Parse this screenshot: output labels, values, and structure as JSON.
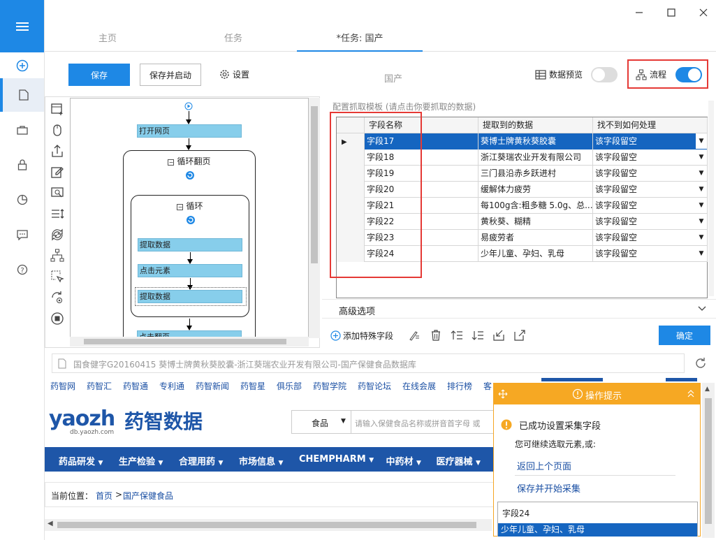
{
  "window": {
    "controls": [
      "minimize",
      "maximize",
      "close"
    ]
  },
  "tabs": [
    {
      "label": "主页"
    },
    {
      "label": "任务"
    },
    {
      "label": "*任务: 国产"
    }
  ],
  "toolbar": {
    "save": "保存",
    "save_start": "保存并启动",
    "settings": "设置",
    "task_name": "国产",
    "data_preview": "数据预览",
    "flow": "流程"
  },
  "flow": {
    "open_page": "打开网页",
    "loop_page": "循环翻页",
    "loop": "循环",
    "extract1": "提取数据",
    "click_elem": "点击元素",
    "extract2": "提取数据",
    "click_next": "点击翻页"
  },
  "config": {
    "title": "配置抓取模板 (请点击你要抓取的数据)",
    "columns": [
      "字段名称",
      "提取到的数据",
      "找不到如何处理"
    ],
    "rows": [
      {
        "name": "字段17",
        "data": "葵博士牌黄秋葵胶囊",
        "action": "该字段留空"
      },
      {
        "name": "字段18",
        "data": "浙江葵瑞农业开发有限公司",
        "action": "该字段留空"
      },
      {
        "name": "字段19",
        "data": "三门县沿赤乡跃进村",
        "action": "该字段留空"
      },
      {
        "name": "字段20",
        "data": "缓解体力疲劳",
        "action": "该字段留空"
      },
      {
        "name": "字段21",
        "data": "每100g含:粗多糖 5.0g、总...",
        "action": "该字段留空"
      },
      {
        "name": "字段22",
        "data": "黄秋葵、糊精",
        "action": "该字段留空"
      },
      {
        "name": "字段23",
        "data": "易疲劳者",
        "action": "该字段留空"
      },
      {
        "name": "字段24",
        "data": "少年儿童、孕妇、乳母",
        "action": "该字段留空"
      }
    ],
    "advanced": "高级选项",
    "add_special": "添加特殊字段",
    "confirm": "确定"
  },
  "browser": {
    "address": "国食健字G20160415 葵博士牌黄秋葵胶囊-浙江葵瑞农业开发有限公司-国产保健食品数据库",
    "site_nav": [
      "药智网",
      "药智汇",
      "药智通",
      "专利通",
      "药智新闻",
      "药智星",
      "俱乐部",
      "药智学院",
      "药智论坛",
      "在线会展",
      "排行榜",
      "客"
    ],
    "logo_text": "药智数据",
    "logo_latin": "yaozh",
    "logo_url": "db.yaozh.com",
    "search_category": "食品",
    "search_placeholder": "请输入保健食品名称或拼音首字母  或",
    "main_nav": [
      "药品研发",
      "生产检验",
      "合理用药",
      "市场信息",
      "CHEMPHARM",
      "中药材",
      "医疗器械"
    ],
    "crumb_prefix": "当前位置：",
    "crumb_home": "首页",
    "crumb_sep": ">",
    "crumb_current": "国产保健食品"
  },
  "tip": {
    "title": "操作提示",
    "success": "已成功设置采集字段",
    "hint": "您可继续选取元素,或:",
    "back": "返回上个页面",
    "save_start": "保存并开始采集",
    "field_name": "字段24",
    "field_value": "少年儿童、孕妇、乳母"
  }
}
